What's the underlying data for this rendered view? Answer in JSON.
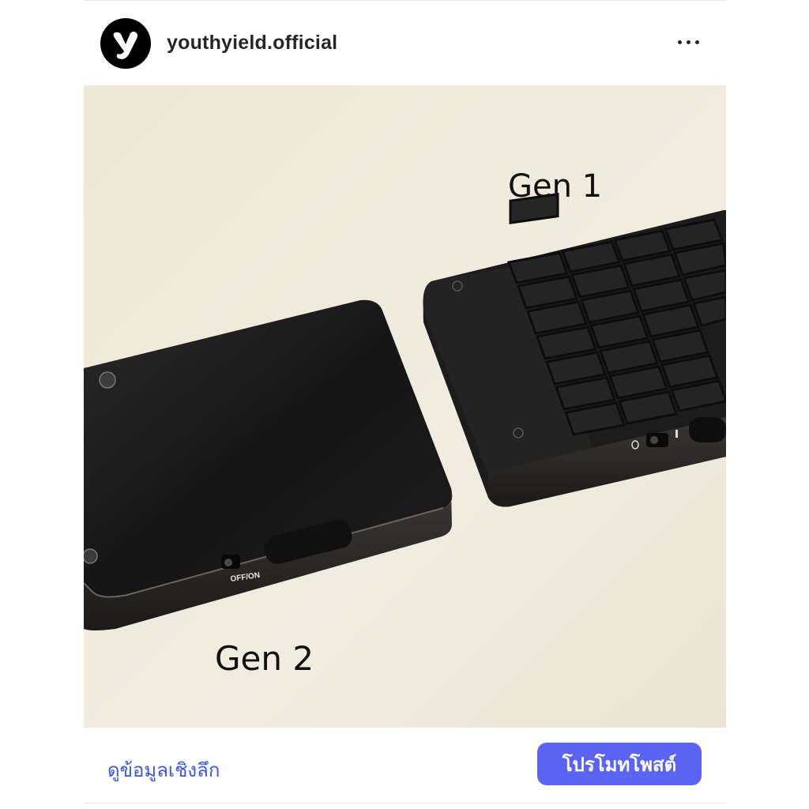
{
  "post": {
    "username": "youthyield.official",
    "avatar_icon": "youthyield-logo-icon",
    "more_icon": "more-horizontal-icon"
  },
  "photo": {
    "label_gen1": "Gen 1",
    "label_gen2": "Gen 2",
    "switch_label": "OFF/ON"
  },
  "footer": {
    "insights_label": "ดูข้อมูลเชิงลึก",
    "promote_label": "โปรโมทโพสต์"
  },
  "colors": {
    "link": "#3b57e6",
    "promote_button": "#5b63f2"
  }
}
